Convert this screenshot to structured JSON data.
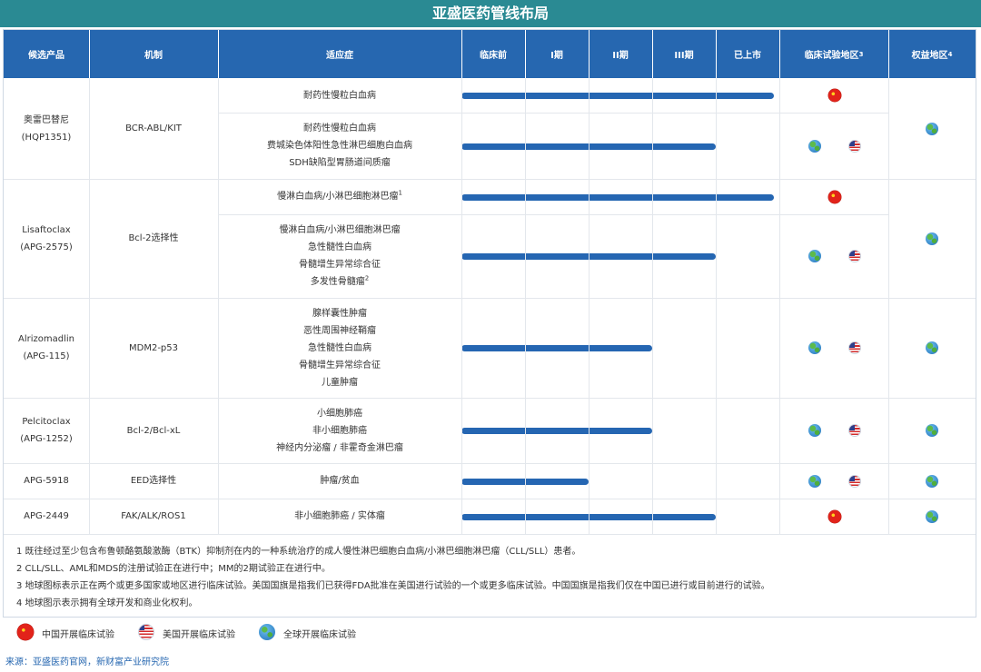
{
  "page": {
    "title": "亚盛医药管线布局",
    "source": "来源：亚盛医药官网，新财富产业研究院"
  },
  "headers": {
    "candidate": "候选产品",
    "mechanism": "机制",
    "indication": "适应症",
    "preclinical": "临床前",
    "phase1": "I期",
    "phase2": "II期",
    "phase3": "III期",
    "launched": "已上市",
    "trial_region": "临床试验地区",
    "trial_region_sup": "3",
    "rights_region": "权益地区",
    "rights_region_sup": "4"
  },
  "rows": [
    {
      "name": "奥雷巴替尼",
      "code": "(HQP1351)",
      "mechanism": "BCR-ABL/KIT",
      "rights": "globe",
      "sub": [
        {
          "lines": [
            "耐药性慢粒白血病"
          ],
          "regions": [
            "cn"
          ]
        },
        {
          "lines": [
            "耐药性慢粒白血病",
            "费城染色体阳性急性淋巴细胞白血病",
            "SDH缺陷型胃肠道间质瘤"
          ],
          "regions": [
            "globe",
            "us"
          ]
        }
      ]
    },
    {
      "name": "Lisaftoclax",
      "code": "(APG-2575)",
      "mechanism": "Bcl-2选择性",
      "rights": "globe",
      "sub": [
        {
          "lines": [
            "慢淋白血病/小淋巴细胞淋巴瘤"
          ],
          "sup": "1",
          "regions": [
            "cn"
          ]
        },
        {
          "lines": [
            "慢淋白血病/小淋巴细胞淋巴瘤",
            "急性髓性白血病",
            "骨髓增生异常综合征",
            "多发性骨髓瘤"
          ],
          "sup": "2",
          "regions": [
            "globe",
            "us"
          ]
        }
      ]
    },
    {
      "name": "Alrizomadlin",
      "code": "(APG-115)",
      "mechanism": "MDM2-p53",
      "rights": "globe",
      "sub": [
        {
          "lines": [
            "腺样囊性肿瘤",
            "恶性周围神经鞘瘤",
            "急性髓性白血病",
            "骨髓增生异常综合征",
            "儿童肿瘤"
          ],
          "regions": [
            "globe",
            "us"
          ]
        }
      ]
    },
    {
      "name": "Pelcitoclax",
      "code": "(APG-1252)",
      "mechanism": "Bcl-2/Bcl-xL",
      "rights": "globe",
      "sub": [
        {
          "lines": [
            "小细胞肺癌",
            "非小细胞肺癌",
            "神经内分泌瘤 / 非霍奇金淋巴瘤"
          ],
          "regions": [
            "globe",
            "us"
          ]
        }
      ]
    },
    {
      "name": "APG-5918",
      "code": "",
      "mechanism": "EED选择性",
      "rights": "globe",
      "sub": [
        {
          "lines": [
            "肿瘤/贫血"
          ],
          "regions": [
            "globe",
            "us"
          ]
        }
      ]
    },
    {
      "name": "APG-2449",
      "code": "",
      "mechanism": "FAK/ALK/ROS1",
      "rights": "globe",
      "sub": [
        {
          "lines": [
            "非小细胞肺癌 / 实体瘤"
          ],
          "regions": [
            "cn"
          ]
        }
      ]
    }
  ],
  "chart_data": {
    "type": "bar",
    "orientation": "horizontal",
    "stages": [
      "临床前",
      "I期",
      "II期",
      "III期",
      "已上市"
    ],
    "bars": [
      {
        "candidate": "奥雷巴替尼 (HQP1351)",
        "indication": "耐药性慢粒白血病",
        "stage": "已上市"
      },
      {
        "candidate": "奥雷巴替尼 (HQP1351)",
        "indication": "耐药性慢粒白血病 / 费城染色体阳性急性淋巴细胞白血病 / SDH缺陷型胃肠道间质瘤",
        "stage": "III期"
      },
      {
        "candidate": "Lisaftoclax (APG-2575)",
        "indication": "慢淋白血病/小淋巴细胞淋巴瘤",
        "stage": "已上市"
      },
      {
        "candidate": "Lisaftoclax (APG-2575)",
        "indication": "慢淋白血病/小淋巴细胞淋巴瘤 / 急性髓性白血病 / 骨髓增生异常综合征 / 多发性骨髓瘤",
        "stage": "III期"
      },
      {
        "candidate": "Alrizomadlin (APG-115)",
        "indication": "腺样囊性肿瘤 / 恶性周围神经鞘瘤 / 急性髓性白血病 / 骨髓增生异常综合征 / 儿童肿瘤",
        "stage": "II期"
      },
      {
        "candidate": "Pelcitoclax (APG-1252)",
        "indication": "小细胞肺癌 / 非小细胞肺癌 / 神经内分泌瘤 / 非霍奇金淋巴瘤",
        "stage": "II期"
      },
      {
        "candidate": "APG-5918",
        "indication": "肿瘤/贫血",
        "stage": "I期"
      },
      {
        "candidate": "APG-2449",
        "indication": "非小细胞肺癌 / 实体瘤",
        "stage": "III期"
      }
    ]
  },
  "footnotes": [
    "1 既往经过至少包含布鲁顿酪氨酸激酶（BTK）抑制剂在内的一种系统治疗的成人慢性淋巴细胞白血病/小淋巴细胞淋巴瘤（CLL/SLL）患者。",
    "2 CLL/SLL、AML和MDS的注册试验正在进行中；MM的2期试验正在进行中。",
    "3 地球图标表示正在两个或更多国家或地区进行临床试验。美国国旗是指我们已获得FDA批准在美国进行试验的一个或更多临床试验。中国国旗是指我们仅在中国已进行或目前进行的试验。",
    "4 地球图示表示拥有全球开发和商业化权利。"
  ],
  "legend": [
    {
      "icon": "china-flag-icon",
      "label": "中国开展临床试验"
    },
    {
      "icon": "us-flag-icon",
      "label": "美国开展临床试验"
    },
    {
      "icon": "globe-icon",
      "label": "全球开展临床试验"
    }
  ],
  "colors": {
    "title_bar": "#2a8a93",
    "header": "#2667b0",
    "bar": "#2566b2"
  }
}
